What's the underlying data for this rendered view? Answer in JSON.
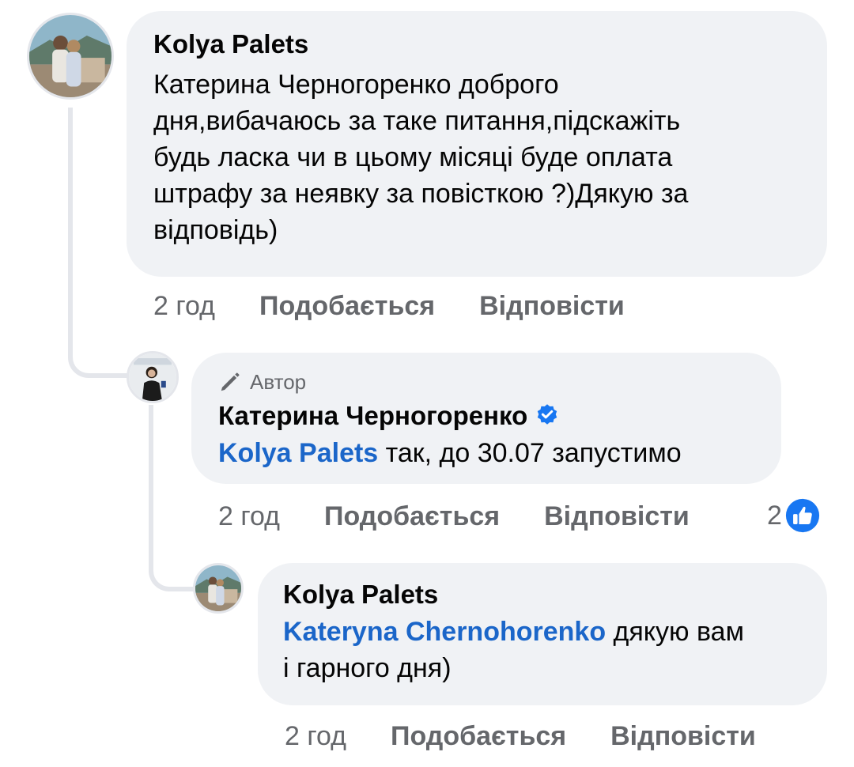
{
  "comment1": {
    "author": "Kolya Palets",
    "text_lines": [
      "Катерина Черногоренко доброго",
      "дня,вибачаюсь за таке питання,підскажіть",
      "будь ласка чи в цьому місяці буде оплата",
      "штрафу за неявку за повісткою ?)Дякую за",
      "відповідь)"
    ],
    "time": "2 год",
    "like_label": "Подобається",
    "reply_label": "Відповісти"
  },
  "comment2": {
    "badge_label": "Автор",
    "badge_icon": "pen-icon",
    "author": "Катерина Черногоренко",
    "verified_icon": "verified-badge-icon",
    "mention": "Kolya Palets",
    "text": "так, до 30.07 запустимо",
    "time": "2 год",
    "like_label": "Подобається",
    "reply_label": "Відповісти",
    "reaction_count": "2",
    "reaction_icon": "like-icon"
  },
  "comment3": {
    "author": "Kolya Palets",
    "mention": "Kateryna Chernohorenko",
    "text_line1": "дякую вам",
    "text_line2": "і гарного дня)",
    "time": "2 год",
    "like_label": "Подобається",
    "reply_label": "Відповісти"
  },
  "colors": {
    "bubble": "#f0f2f5",
    "mention": "#1b66c9",
    "meta_text": "#65676b",
    "verified": "#1877f2"
  }
}
